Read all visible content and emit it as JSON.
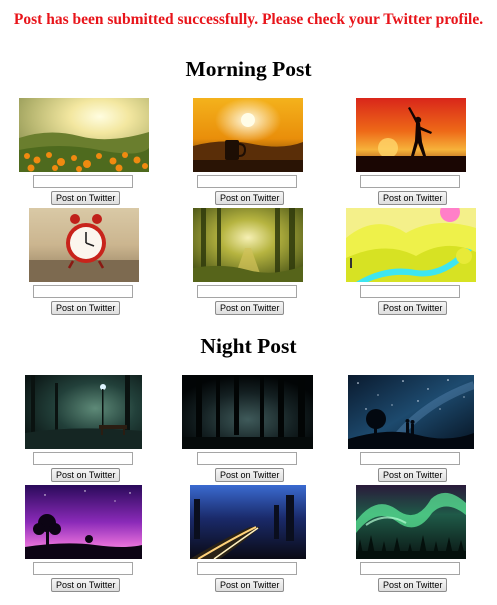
{
  "status": {
    "message": "Post has been submitted successfully. Please check your Twitter profile.",
    "color": "#e8141a"
  },
  "sections": [
    {
      "title": "Morning Post",
      "items": [
        {
          "image": "sunrise-flower-field-image",
          "input_value": "",
          "button": "Post on Twitter"
        },
        {
          "image": "sunrise-coffee-cup-image",
          "input_value": "",
          "button": "Post on Twitter"
        },
        {
          "image": "sunset-dancer-silhouette-image",
          "input_value": "",
          "button": "Post on Twitter"
        },
        {
          "image": "red-alarm-clock-image",
          "input_value": "",
          "button": "Post on Twitter"
        },
        {
          "image": "sunlit-forest-image",
          "input_value": "",
          "button": "Post on Twitter"
        },
        {
          "image": "yellow-hills-river-illustration-image",
          "input_value": "",
          "button": "Post on Twitter"
        }
      ]
    },
    {
      "title": "Night Post",
      "items": [
        {
          "image": "night-park-bench-image",
          "input_value": "",
          "button": "Post on Twitter"
        },
        {
          "image": "dark-forest-night-image",
          "input_value": "",
          "button": "Post on Twitter"
        },
        {
          "image": "starry-sky-couple-image",
          "input_value": "",
          "button": "Post on Twitter"
        },
        {
          "image": "purple-sky-tree-image",
          "input_value": "",
          "button": "Post on Twitter"
        },
        {
          "image": "night-road-light-trails-image",
          "input_value": "",
          "button": "Post on Twitter"
        },
        {
          "image": "northern-lights-image",
          "input_value": "",
          "button": "Post on Twitter"
        }
      ]
    }
  ]
}
